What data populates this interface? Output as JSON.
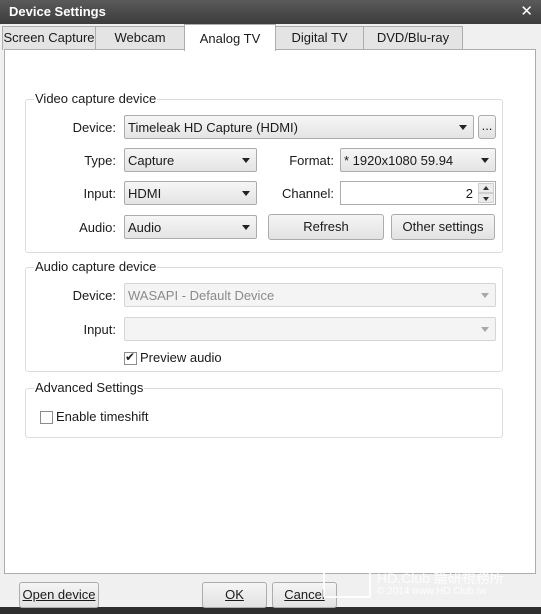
{
  "window": {
    "title": "Device Settings",
    "close_glyph": "✕"
  },
  "tabs": [
    {
      "label": "Screen Capture"
    },
    {
      "label": "Webcam"
    },
    {
      "label": "Analog TV"
    },
    {
      "label": "Digital TV"
    },
    {
      "label": "DVD/Blu-ray"
    }
  ],
  "active_tab": "Analog TV",
  "video_group": {
    "title": "Video capture device",
    "device_label": "Device:",
    "device_value": "Timeleak HD Capture (HDMI)",
    "browse_label": "...",
    "type_label": "Type:",
    "type_value": "Capture",
    "format_label": "Format:",
    "format_value": "* 1920x1080 59.94",
    "input_label": "Input:",
    "input_value": "HDMI",
    "channel_label": "Channel:",
    "channel_value": "2",
    "audio_label": "Audio:",
    "audio_value": "Audio",
    "refresh_label": "Refresh",
    "other_label": "Other settings"
  },
  "audio_group": {
    "title": "Audio capture device",
    "device_label": "Device:",
    "device_value": "WASAPI - Default Device",
    "input_label": "Input:",
    "input_value": "",
    "preview_label": "Preview audio",
    "preview_checked": true
  },
  "advanced_group": {
    "title": "Advanced Settings",
    "timeshift_label": "Enable timeshift",
    "timeshift_checked": false
  },
  "footer": {
    "open_device": "Open device",
    "ok": "OK",
    "cancel": "Cancel"
  },
  "watermark": {
    "line1": "HD.Club 論研視務所",
    "line2": "© 2014  www.HD.Club.tw"
  }
}
